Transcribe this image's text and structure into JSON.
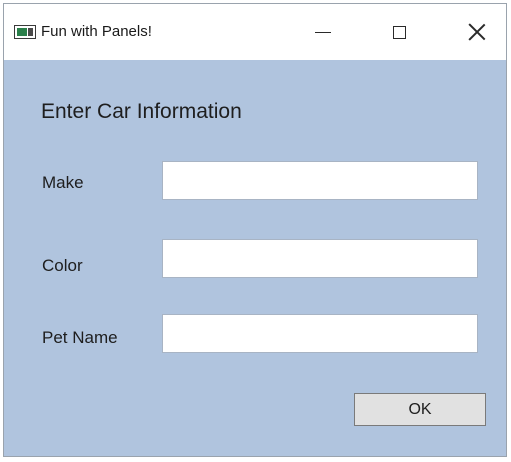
{
  "window": {
    "title": "Fun with Panels!",
    "background_color": "#b0c4de",
    "icons": {
      "app": "app-window-icon",
      "minimize": "minimize-icon",
      "maximize": "maximize-icon",
      "close": "close-icon"
    }
  },
  "form": {
    "heading": "Enter Car Information",
    "fields": [
      {
        "label": "Make",
        "value": "",
        "placeholder": ""
      },
      {
        "label": "Color",
        "value": "",
        "placeholder": ""
      },
      {
        "label": "Pet Name",
        "value": "",
        "placeholder": ""
      }
    ],
    "ok_label": "OK"
  }
}
